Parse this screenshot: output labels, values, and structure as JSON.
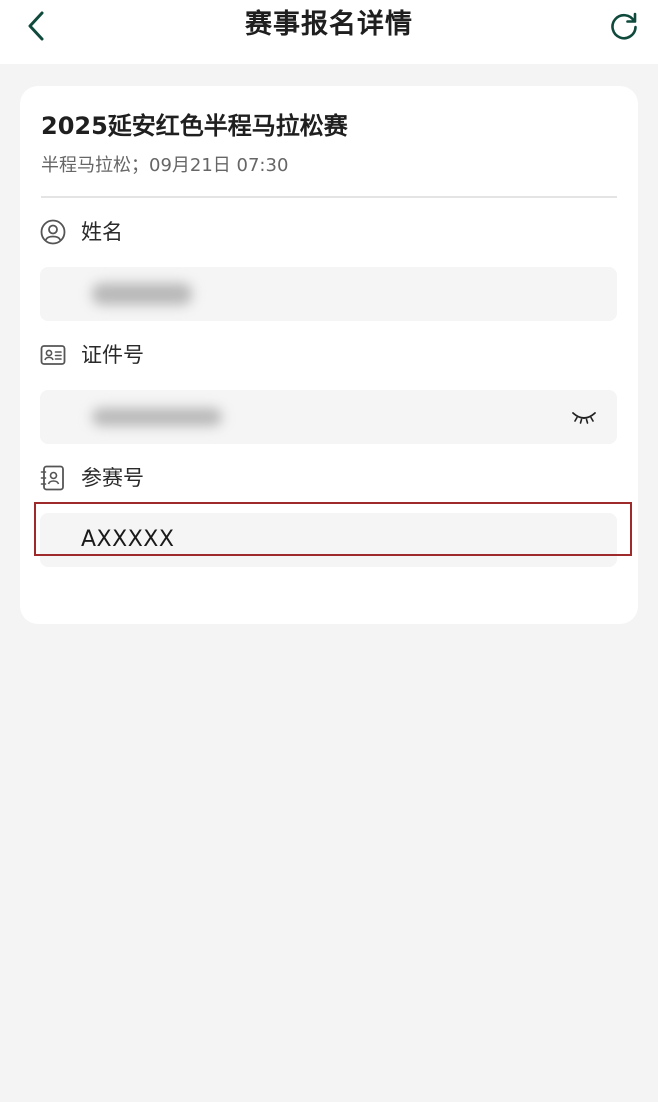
{
  "header": {
    "title": "赛事报名详情",
    "back_icon": "chevron-left-icon",
    "refresh_icon": "refresh-icon"
  },
  "event": {
    "title": "2025延安红色半程马拉松赛",
    "meta": "半程马拉松；09月21日 07:30"
  },
  "fields": {
    "name": {
      "label": "姓名",
      "icon": "user-circle-icon"
    },
    "id_number": {
      "label": "证件号",
      "icon": "id-card-icon"
    },
    "bib_number": {
      "label": "参赛号",
      "icon": "contact-book-icon",
      "value": "AXXXXX"
    }
  },
  "colors": {
    "accent": "#0f4a3c",
    "highlight_border": "#9e2a2b",
    "page_bg": "#f4f4f4",
    "field_bg": "#f5f5f5"
  }
}
